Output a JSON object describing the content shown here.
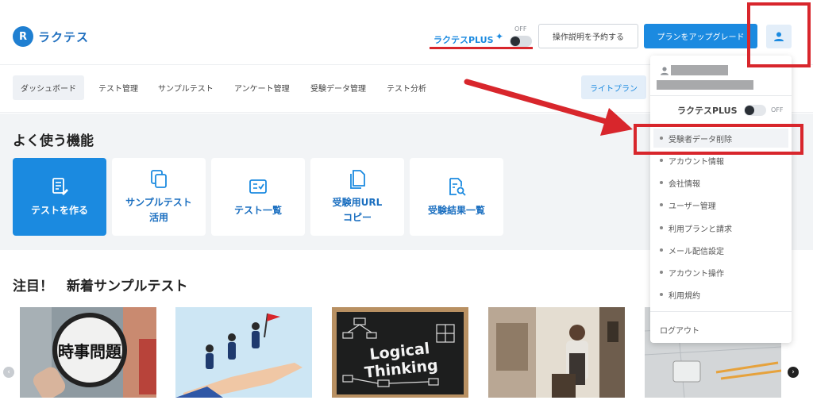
{
  "header": {
    "logo_mark": "R",
    "logo_text": "ラクテス",
    "plus_label": "ラクテスPLUS",
    "plus_off": "OFF",
    "manual_button": "操作説明を予約する",
    "upgrade_button": "プランをアップグレード"
  },
  "nav": {
    "items": [
      "ダッシュボード",
      "テスト管理",
      "サンプルテスト",
      "アンケート管理",
      "受験データ管理",
      "テスト分析"
    ],
    "plan": "ライトプラン"
  },
  "features": {
    "title": "よく使う機能",
    "cards": [
      "テストを作る",
      "サンプルテスト\n活用",
      "テスト一覧",
      "受験用URL\nコピー",
      "受験結果一覧"
    ]
  },
  "samples": {
    "title": "注目！　新着サンプルテスト",
    "thumb_texts": [
      "時事問題",
      "Logical",
      "Thinking"
    ]
  },
  "dropdown": {
    "plus_label": "ラクテスPLUS",
    "plus_off": "OFF",
    "items": [
      "受験者データ削除",
      "アカウント情報",
      "会社情報",
      "ユーザー管理",
      "利用プランと請求",
      "メール配信設定",
      "アカウント操作",
      "利用規約"
    ],
    "logout": "ログアウト"
  },
  "colors": {
    "accent": "#1b8ae0",
    "annotation_red": "#d8262c",
    "feature_bg": "#f2f4f6"
  }
}
